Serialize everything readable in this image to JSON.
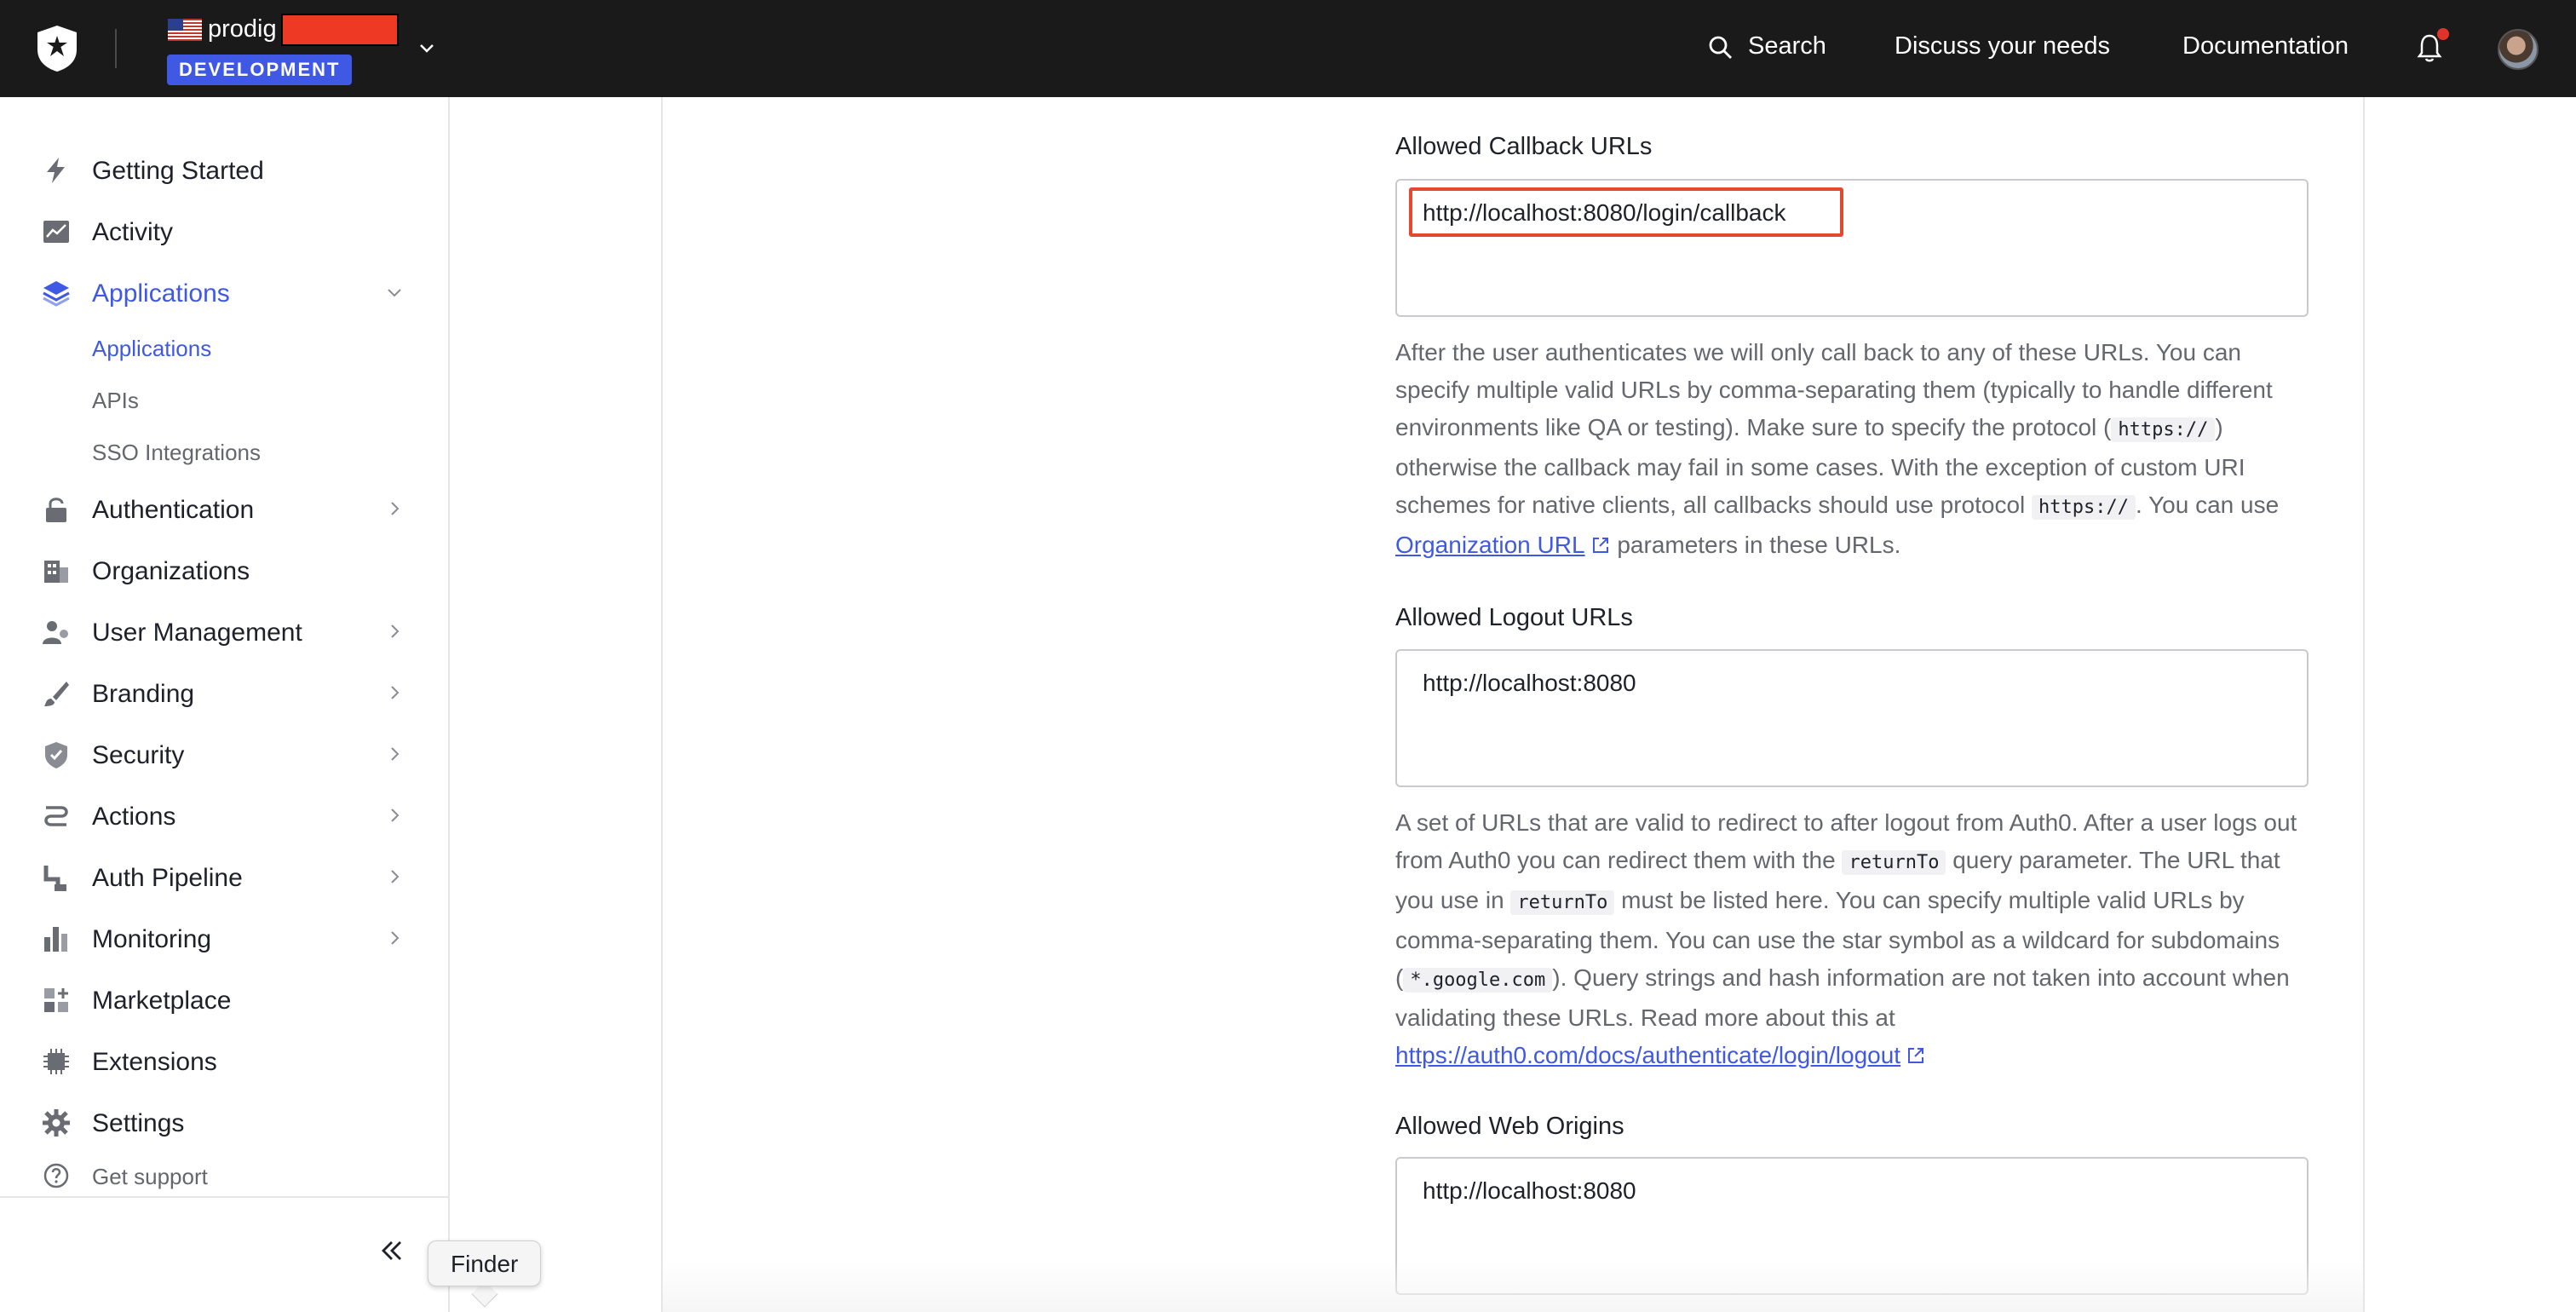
{
  "header": {
    "tenant_flag": "us-flag-icon",
    "tenant_name": "prodig",
    "environment_badge": "DEVELOPMENT",
    "nav": {
      "search": "Search",
      "discuss": "Discuss your needs",
      "documentation": "Documentation"
    }
  },
  "sidebar": {
    "items": [
      {
        "label": "Getting Started",
        "icon": "lightning-icon"
      },
      {
        "label": "Activity",
        "icon": "activity-chart-icon"
      },
      {
        "label": "Applications",
        "icon": "layers-icon"
      },
      {
        "label": "Authentication",
        "icon": "lock-icon"
      },
      {
        "label": "Organizations",
        "icon": "building-icon"
      },
      {
        "label": "User Management",
        "icon": "users-icon"
      },
      {
        "label": "Branding",
        "icon": "brush-icon"
      },
      {
        "label": "Security",
        "icon": "shield-icon"
      },
      {
        "label": "Actions",
        "icon": "flow-icon"
      },
      {
        "label": "Auth Pipeline",
        "icon": "pipeline-icon"
      },
      {
        "label": "Monitoring",
        "icon": "bar-chart-icon"
      },
      {
        "label": "Marketplace",
        "icon": "grid-plus-icon"
      },
      {
        "label": "Extensions",
        "icon": "chip-icon"
      },
      {
        "label": "Settings",
        "icon": "gear-icon"
      }
    ],
    "sub_items": [
      "Applications",
      "APIs",
      "SSO Integrations"
    ],
    "get_support": "Get support",
    "tooltip": "Finder",
    "accent_color": "#3f59e4"
  },
  "form": {
    "callback": {
      "label": "Allowed Callback URLs",
      "value": "http://localhost:8080/login/callback",
      "help_1": "After the user authenticates we will only call back to any of these URLs. You can specify multiple valid URLs by comma-separating them (typically to handle different environments like QA or testing). Make sure to specify the protocol (",
      "help_code_1": "https://",
      "help_2": ") otherwise the callback may fail in some cases. With the exception of custom URI schemes for native clients, all callbacks should use protocol",
      "help_code_2": "https://",
      "help_3": ". You can use",
      "help_link": "Organization URL",
      "help_4": "parameters in these URLs."
    },
    "logout": {
      "label": "Allowed Logout URLs",
      "value": "http://localhost:8080",
      "help_1": "A set of URLs that are valid to redirect to after logout from Auth0. After a user logs out from Auth0 you can redirect them with the",
      "help_code_1": "returnTo",
      "help_2": "query parameter. The URL that you use in",
      "help_code_2": "returnTo",
      "help_3": "must be listed here. You can specify multiple valid URLs by comma-separating them. You can use the star symbol as a wildcard for subdomains (",
      "help_code_3": "*.google.com",
      "help_4": "). Query strings and hash information are not taken into account when validating these URLs. Read more about this at",
      "help_link": "https://auth0.com/docs/authenticate/login/logout"
    },
    "web_origins": {
      "label": "Allowed Web Origins",
      "value": "http://localhost:8080"
    }
  }
}
